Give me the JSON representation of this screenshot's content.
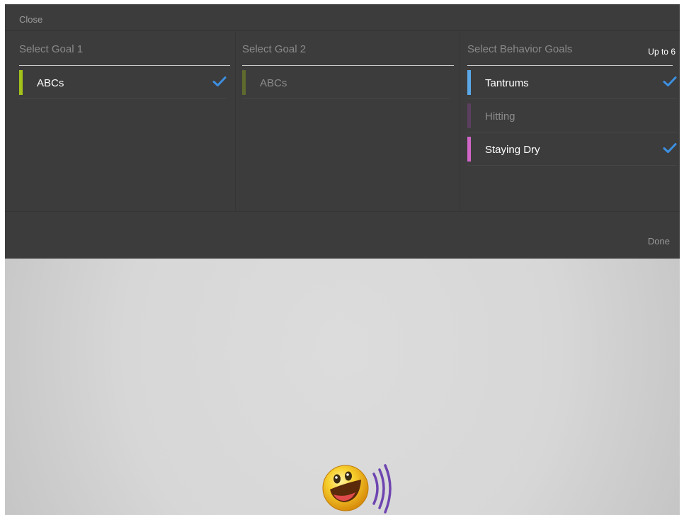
{
  "topbar": {
    "close_label": "Close"
  },
  "columns": [
    {
      "header": "Select Goal 1",
      "items": [
        {
          "label": "ABCs",
          "color": "#a3c21a",
          "selected": true,
          "dim": false
        }
      ]
    },
    {
      "header": "Select Goal 2",
      "items": [
        {
          "label": "ABCs",
          "color": "#5e6a2e",
          "selected": false,
          "dim": true
        }
      ]
    },
    {
      "header": "Select Behavior Goals",
      "limit_label": "Up to 6",
      "items": [
        {
          "label": "Tantrums",
          "color": "#5aa8e8",
          "selected": true,
          "dim": false
        },
        {
          "label": "Hitting",
          "color": "#5a3f5e",
          "selected": false,
          "dim": true
        },
        {
          "label": "Staying Dry",
          "color": "#d066c8",
          "selected": true,
          "dim": false
        }
      ]
    }
  ],
  "footer": {
    "done_label": "Done"
  },
  "icons": {
    "check": "checkmark-icon",
    "logo": "smiley-sound-logo-icon"
  },
  "colors": {
    "check": "#3d8fe0",
    "panel": "#3c3c3c"
  }
}
